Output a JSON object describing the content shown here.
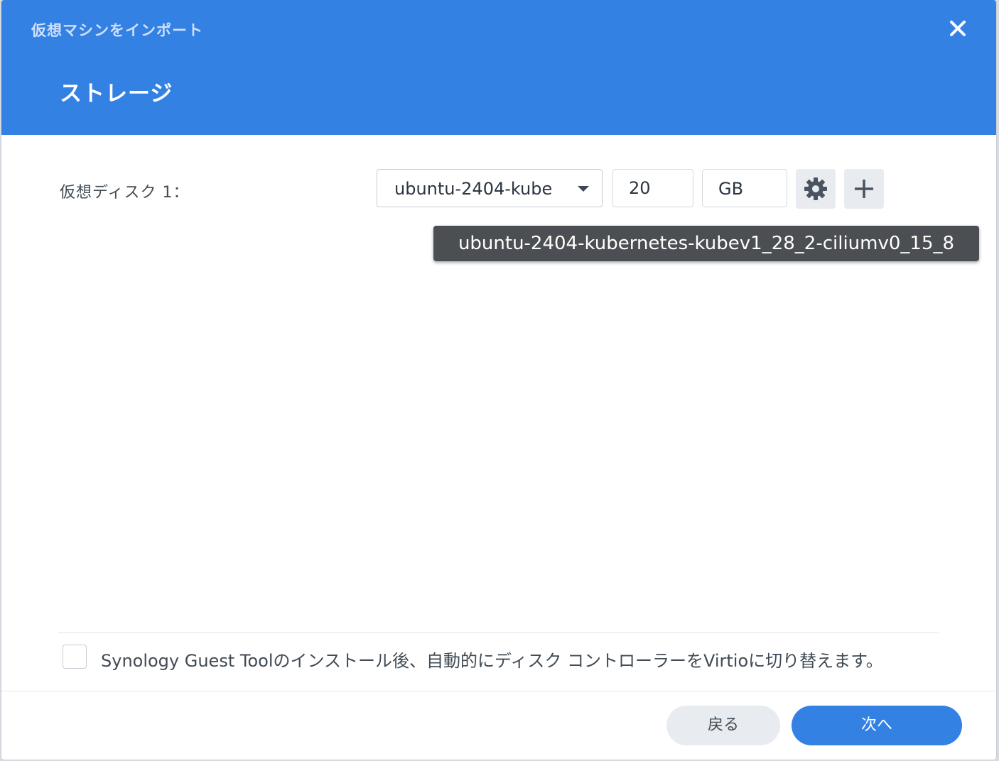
{
  "dialog": {
    "window_title": "仮想マシンをインポート",
    "step_title": "ストレージ"
  },
  "disk": {
    "label": "仮想ディスク 1：",
    "image_selected": "ubuntu-2404-kubernetes-kubev1_28_2-ciliumv0_15_8",
    "image_visible": "ubuntu-2404-kube",
    "size_value": "20",
    "unit": "GB",
    "tooltip": "ubuntu-2404-kubernetes-kubev1_28_2-ciliumv0_15_8"
  },
  "option": {
    "checkbox_label": "Synology Guest Toolのインストール後、自動的にディスク コントローラーをVirtioに切り替えます。",
    "checked": false
  },
  "footer": {
    "back_label": "戻る",
    "next_label": "次へ"
  },
  "colors": {
    "header": "#3481e4",
    "primary_button": "#3481e4",
    "tooltip_bg": "#4b4e52"
  },
  "icons": {
    "close": "close-icon",
    "settings": "gear-icon",
    "add": "plus-icon",
    "dropdown": "caret-down-icon"
  }
}
